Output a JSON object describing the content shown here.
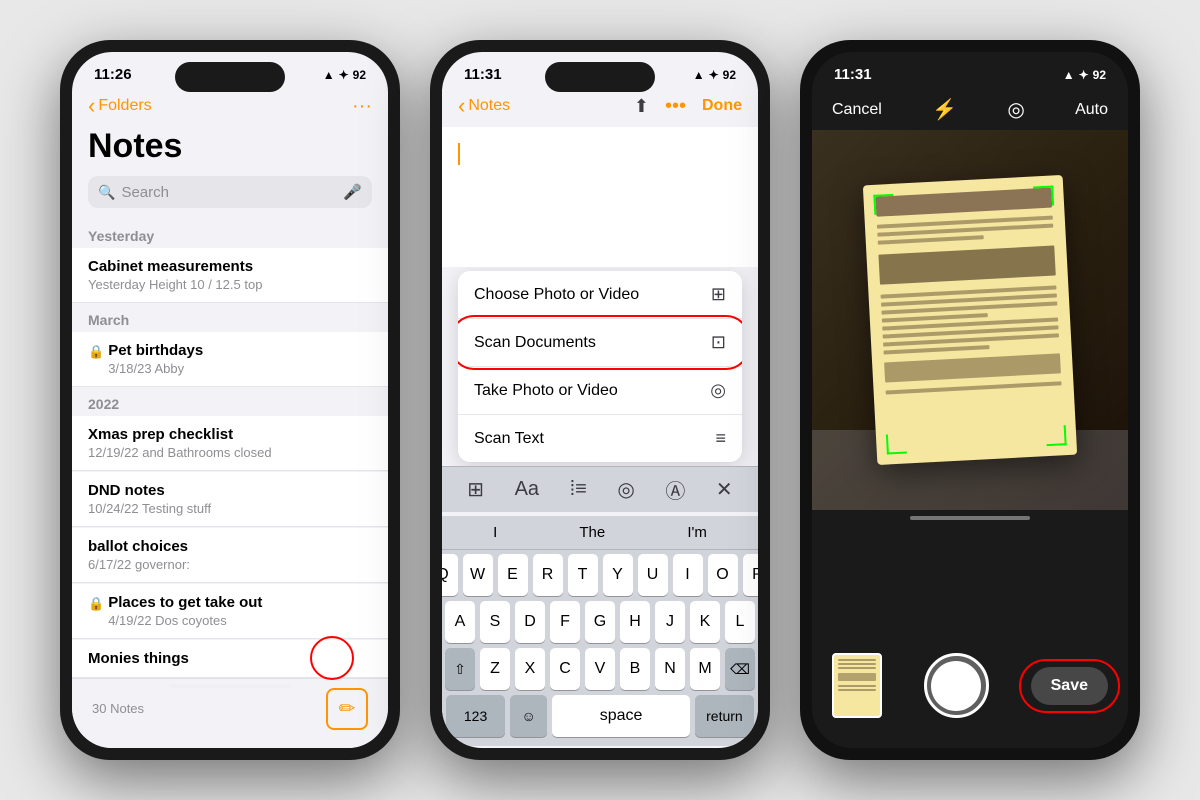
{
  "phone1": {
    "time": "11:26",
    "status_icons": "▲ ✦ 92",
    "nav_back": "Folders",
    "nav_right": "···",
    "title": "Notes",
    "search_placeholder": "Search",
    "sections": [
      {
        "header": "Yesterday",
        "items": [
          {
            "title": "Cabinet measurements",
            "meta": "Yesterday  Height 10 / 12.5 top",
            "locked": false
          }
        ]
      },
      {
        "header": "March",
        "items": [
          {
            "title": "Pet birthdays",
            "meta": "3/18/23  Abby",
            "locked": true
          }
        ]
      },
      {
        "header": "2022",
        "items": [
          {
            "title": "Xmas prep checklist",
            "meta": "12/19/22  and Bathrooms closed",
            "locked": false
          },
          {
            "title": "DND notes",
            "meta": "10/24/22  Testing stuff",
            "locked": false
          },
          {
            "title": "ballot choices",
            "meta": "6/17/22  governor:",
            "locked": false
          },
          {
            "title": "Places to get take out",
            "meta": "4/19/22  Dos coyotes",
            "locked": true
          },
          {
            "title": "Monies things",
            "meta": "",
            "locked": false
          }
        ]
      }
    ],
    "notes_count": "30 Notes"
  },
  "phone2": {
    "time": "11:31",
    "status_icons": "▲ ✦ 92",
    "nav_back": "Notes",
    "done_label": "Done",
    "menu_items": [
      {
        "label": "Choose Photo or Video",
        "icon": "⊞"
      },
      {
        "label": "Scan Documents",
        "icon": "⊡",
        "highlighted": true
      },
      {
        "label": "Take Photo or Video",
        "icon": "◎"
      },
      {
        "label": "Scan Text",
        "icon": "≡"
      }
    ],
    "toolbar_icons": [
      "⊞",
      "Aa",
      "⁞≡",
      "◎",
      "Ⓐ",
      "✕"
    ],
    "suggestions": [
      "I",
      "The",
      "I'm"
    ],
    "keyboard_rows": [
      [
        "Q",
        "W",
        "E",
        "R",
        "T",
        "Y",
        "U",
        "I",
        "O",
        "P"
      ],
      [
        "A",
        "S",
        "D",
        "F",
        "G",
        "H",
        "J",
        "K",
        "L"
      ],
      [
        "⇧",
        "Z",
        "X",
        "C",
        "V",
        "B",
        "N",
        "M",
        "⌫"
      ],
      [
        "123",
        "space",
        "return"
      ]
    ]
  },
  "phone3": {
    "time": "11:31",
    "cancel_label": "Cancel",
    "auto_label": "Auto",
    "save_label": "Save"
  },
  "colors": {
    "accent": "#ff9500",
    "red_circle": "#ff0000",
    "scan_green": "#00ff00"
  }
}
